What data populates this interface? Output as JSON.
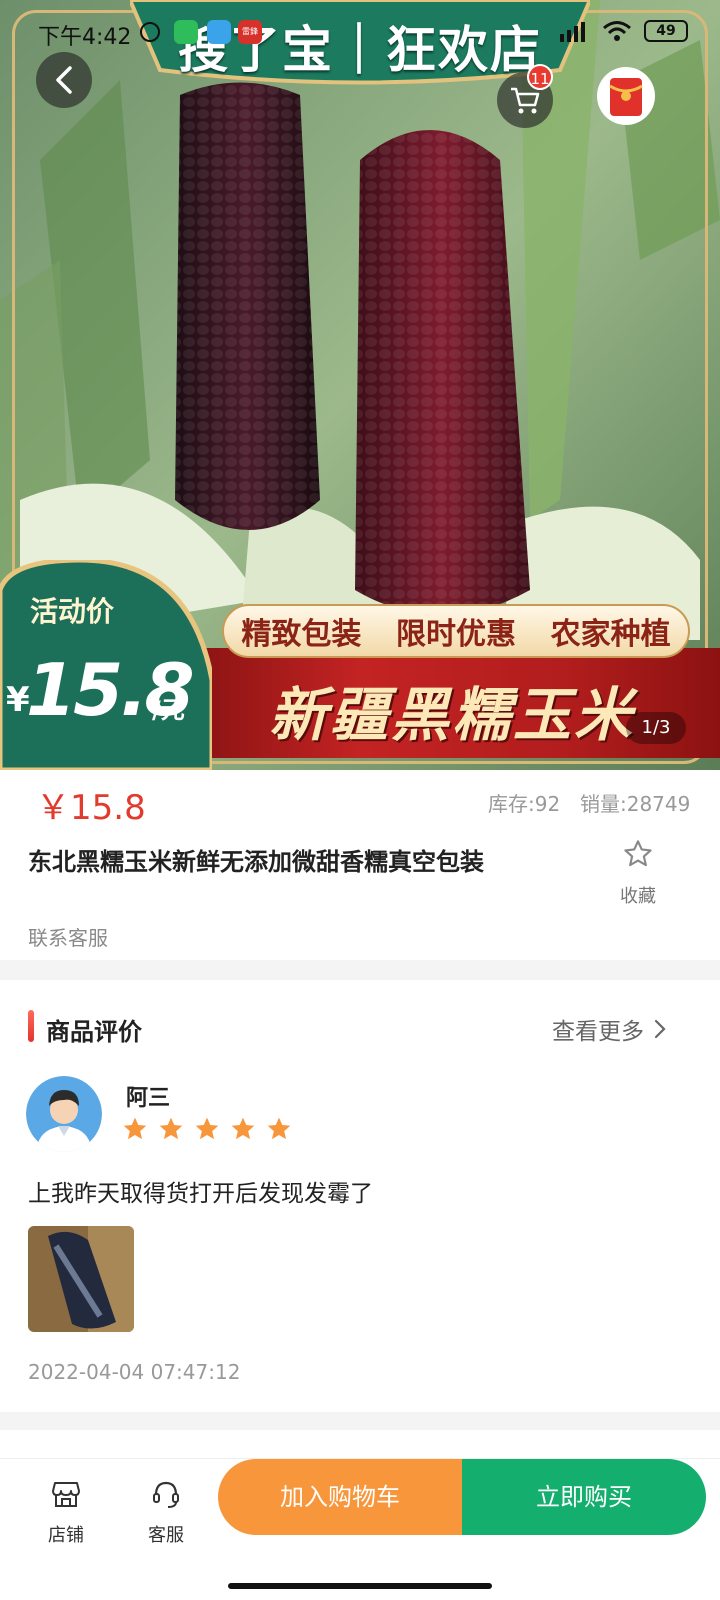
{
  "status_bar": {
    "time": "下午4:42",
    "battery": "49",
    "app_icons": [
      "wechat-icon",
      "qq-icon",
      "news-icon"
    ],
    "news_app_text": "雷鋒"
  },
  "hero": {
    "banner_title": "搜了宝｜狂欢店",
    "cart_count": "11",
    "badge": {
      "label": "活动价",
      "currency": "¥",
      "price": "15.8",
      "unit": "/元"
    },
    "tags": [
      "精致包装",
      "限时优惠",
      "农家种植"
    ],
    "product_art_name": "新疆黑糯玉米",
    "page_indicator": "1/3"
  },
  "product": {
    "price": "￥15.8",
    "stock": "库存:92",
    "sales": "销量:28749",
    "title": "东北黑糯玉米新鲜无添加微甜香糯真空包装",
    "favorite_label": "收藏",
    "contact": "联系客服"
  },
  "reviews": {
    "section_title": "商品评价",
    "see_more": "查看更多",
    "items": [
      {
        "user": "阿三",
        "rating": 5,
        "text": "上我昨天取得货打开后发现发霉了",
        "time": "2022-04-04 07:47:12"
      }
    ]
  },
  "bottom_bar": {
    "shop_label": "店铺",
    "service_label": "客服",
    "add_to_cart": "加入购物车",
    "buy_now": "立即购买"
  },
  "colors": {
    "price_red": "#e23a2c",
    "add_to_cart": "#f7963a",
    "buy_now": "#14ae6e",
    "star": "#f7963a"
  }
}
